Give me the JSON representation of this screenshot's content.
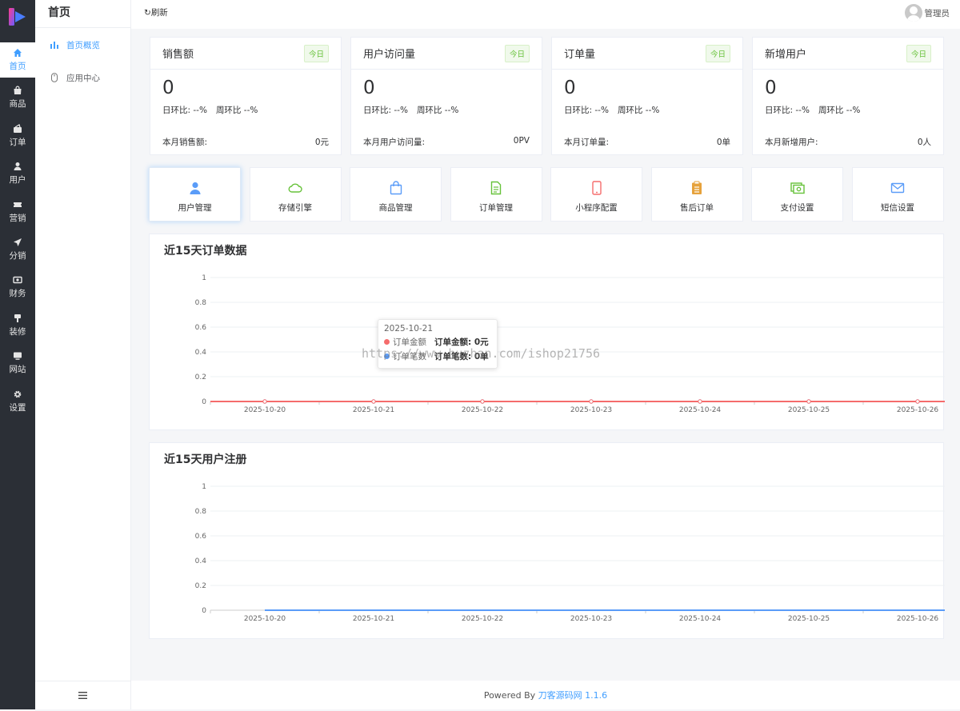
{
  "rail": [
    {
      "label": "首页",
      "icon": "home-icon",
      "active": true
    },
    {
      "label": "商品",
      "icon": "bag-icon"
    },
    {
      "label": "订单",
      "icon": "order-icon"
    },
    {
      "label": "用户",
      "icon": "user-icon"
    },
    {
      "label": "营销",
      "icon": "ticket-icon"
    },
    {
      "label": "分销",
      "icon": "send-icon"
    },
    {
      "label": "财务",
      "icon": "money-icon"
    },
    {
      "label": "装修",
      "icon": "brush-icon"
    },
    {
      "label": "网站",
      "icon": "monitor-icon"
    },
    {
      "label": "设置",
      "icon": "gear-icon"
    }
  ],
  "sub": {
    "title": "首页",
    "items": [
      {
        "label": "首页概览",
        "icon": "bar-chart-icon",
        "active": true
      },
      {
        "label": "应用中心",
        "icon": "mouse-icon"
      }
    ]
  },
  "topbar": {
    "refresh": "刷新",
    "user": "管理员"
  },
  "stats": [
    {
      "title": "销售额",
      "tag": "今日",
      "value": "0",
      "day": "日环比: --%",
      "week": "周环比 --%",
      "month_label": "本月销售额:",
      "month_value": "0元"
    },
    {
      "title": "用户访问量",
      "tag": "今日",
      "value": "0",
      "day": "日环比: --%",
      "week": "周环比 --%",
      "month_label": "本月用户访问量:",
      "month_value": "0PV"
    },
    {
      "title": "订单量",
      "tag": "今日",
      "value": "0",
      "day": "日环比: --%",
      "week": "周环比 --%",
      "month_label": "本月订单量:",
      "month_value": "0单"
    },
    {
      "title": "新增用户",
      "tag": "今日",
      "value": "0",
      "day": "日环比: --%",
      "week": "周环比 --%",
      "month_label": "本月新增用户:",
      "month_value": "0人"
    }
  ],
  "quick": [
    {
      "label": "用户管理",
      "icon": "user-icon",
      "color": "#5a9cf8"
    },
    {
      "label": "存储引擎",
      "icon": "cloud-icon",
      "color": "#67c23a"
    },
    {
      "label": "商品管理",
      "icon": "shopping-bag-icon",
      "color": "#5a9cf8"
    },
    {
      "label": "订单管理",
      "icon": "document-icon",
      "color": "#67c23a"
    },
    {
      "label": "小程序配置",
      "icon": "phone-icon",
      "color": "#f56c6c"
    },
    {
      "label": "售后订单",
      "icon": "clipboard-icon",
      "color": "#e6a23c"
    },
    {
      "label": "支付设置",
      "icon": "cash-icon",
      "color": "#67c23a"
    },
    {
      "label": "短信设置",
      "icon": "mail-icon",
      "color": "#5a9cf8"
    }
  ],
  "tooltip": {
    "date": "2025-10-21",
    "row1_name": "订单金额",
    "row1_value": "订单金额: 0元",
    "row1_color": "#f56c6c",
    "row2_name": "订单笔数",
    "row2_value": "订单笔数: 0单",
    "row2_color": "#5a9cf8"
  },
  "watermark": "https://www.huzhan.com/ishop21756",
  "chart_data": [
    {
      "type": "line",
      "title": "近15天订单数据",
      "x": [
        "2025-10-20",
        "2025-10-21",
        "2025-10-22",
        "2025-10-23",
        "2025-10-24",
        "2025-10-25",
        "2025-10-26"
      ],
      "series": [
        {
          "name": "订单金额",
          "values": [
            0,
            0,
            0,
            0,
            0,
            0,
            0
          ],
          "color": "#f56c6c"
        },
        {
          "name": "订单笔数",
          "values": [
            0,
            0,
            0,
            0,
            0,
            0,
            0
          ],
          "color": "#5a9cf8"
        }
      ],
      "yticks": [
        "0",
        "0.2",
        "0.4",
        "0.6",
        "0.8",
        "1"
      ],
      "ylim": [
        0,
        1
      ],
      "grid": true
    },
    {
      "type": "line",
      "title": "近15天用户注册",
      "x": [
        "2025-10-20",
        "2025-10-21",
        "2025-10-22",
        "2025-10-23",
        "2025-10-24",
        "2025-10-25",
        "2025-10-26"
      ],
      "series": [
        {
          "values": [
            0,
            0,
            0,
            0,
            0,
            0,
            0
          ],
          "color": "#5a9cf8"
        }
      ],
      "yticks": [
        "0",
        "0.2",
        "0.4",
        "0.6",
        "0.8",
        "1"
      ],
      "ylim": [
        0,
        1
      ],
      "grid": true
    }
  ],
  "footer": {
    "prefix": "Powered By ",
    "link": "刀客源码网 1.1.6"
  }
}
